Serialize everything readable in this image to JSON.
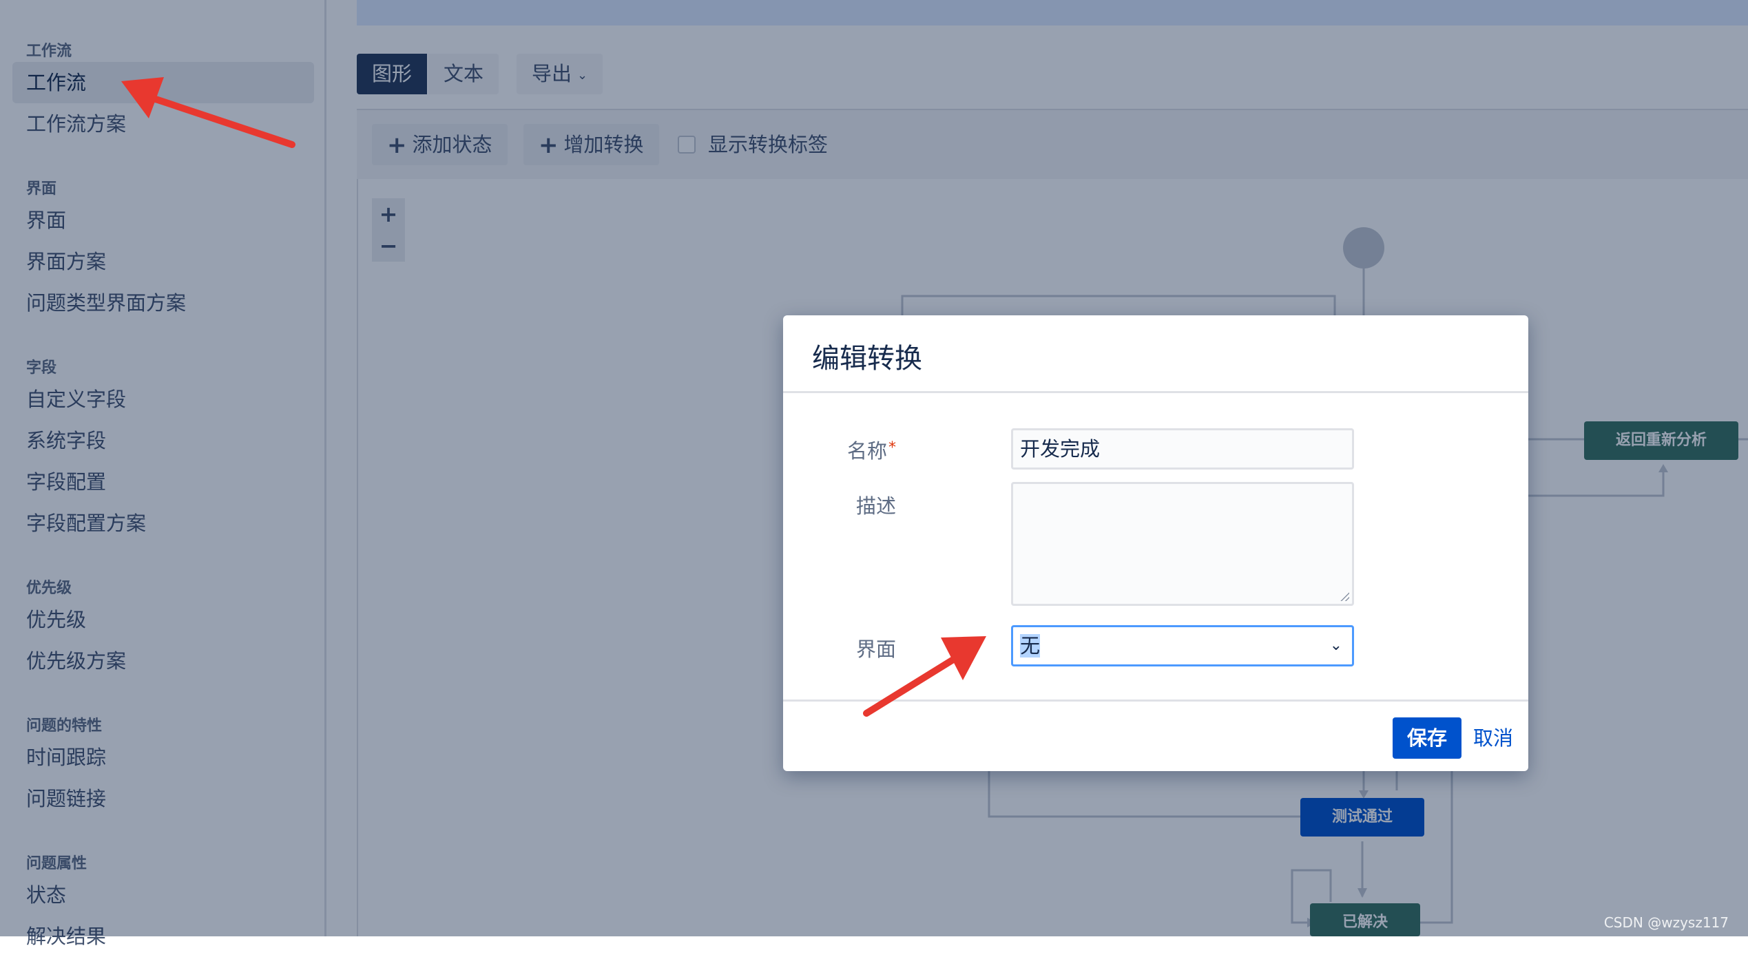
{
  "sidebar": {
    "groups": [
      {
        "title": "工作流",
        "items": [
          "工作流",
          "工作流方案"
        ]
      },
      {
        "title": "界面",
        "items": [
          "界面",
          "界面方案",
          "问题类型界面方案"
        ]
      },
      {
        "title": "字段",
        "items": [
          "自定义字段",
          "系统字段",
          "字段配置",
          "字段配置方案"
        ]
      },
      {
        "title": "优先级",
        "items": [
          "优先级",
          "优先级方案"
        ]
      },
      {
        "title": "问题的特性",
        "items": [
          "时间跟踪",
          "问题链接"
        ]
      },
      {
        "title": "问题属性",
        "items": [
          "状态",
          "解决结果"
        ]
      }
    ],
    "active_item": "工作流"
  },
  "view_tabs": {
    "graph": "图形",
    "text": "文本",
    "export": "导出"
  },
  "toolbar": {
    "add_status": "添加状态",
    "add_transition": "增加转换",
    "show_transition_labels": "显示转换标签",
    "zoom_in": "+",
    "zoom_out": "−"
  },
  "workflow": {
    "nodes": [
      {
        "label": "返回重新分析",
        "color": "#36715f"
      },
      {
        "label": "测试通过",
        "color": "#0052cc"
      },
      {
        "label": "已解决",
        "color": "#36715f"
      }
    ]
  },
  "dialog": {
    "title": "编辑转换",
    "name_label": "名称",
    "required_mark": "*",
    "name_value": "开发完成",
    "description_label": "描述",
    "description_value": "",
    "screen_label": "界面",
    "screen_value": "无",
    "save": "保存",
    "cancel": "取消"
  },
  "annotation_color": "#e8382f",
  "watermark": "CSDN @wzysz117"
}
